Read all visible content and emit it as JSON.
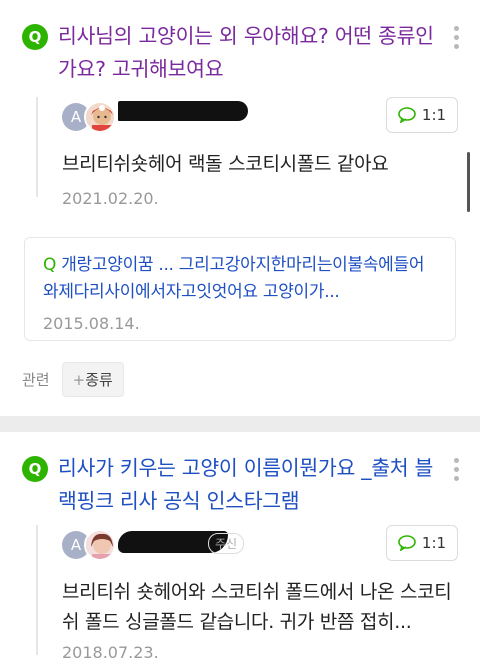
{
  "items": [
    {
      "question": "리사님의 고양이는 외 우아해요? 어떤 종류인가요? 고귀해보여요",
      "answer": {
        "avatar_letter": "A",
        "count_badge": "1:1",
        "text": "브리티쉬숏헤어 랙돌 스코티시폴드 같아요",
        "date": "2021.02.20."
      },
      "related": {
        "text": "개랑고양이꿈 ... 그리고강아지한마리는이불속에들어와제다리사이에서자고잇엇어요 고양이가...",
        "date": "2015.08.14."
      },
      "tags_label": "관련",
      "tags": [
        "종류"
      ]
    },
    {
      "question": "리사가 키우는 고양이 이름이뭔가요 _출처 블랙핑크 리사 공식 인스타그램",
      "answer": {
        "avatar_letter": "A",
        "status_suffix": "주신",
        "count_badge": "1:1",
        "text": "브리티쉬 숏헤어와 스코티쉬 폴드에서 나온 스코티쉬 폴드 싱글폴드 같습니다. 귀가 반쯤 접히...",
        "date": "2018.07.23."
      }
    }
  ],
  "colors": {
    "q_badge": "#2db400",
    "visited_title": "#7b2a9e",
    "link_title": "#1e4fc3",
    "muted": "#999999"
  },
  "icons": {
    "q_badge": "Q",
    "chat": "chat-bubble-icon",
    "plus": "plus-icon"
  }
}
